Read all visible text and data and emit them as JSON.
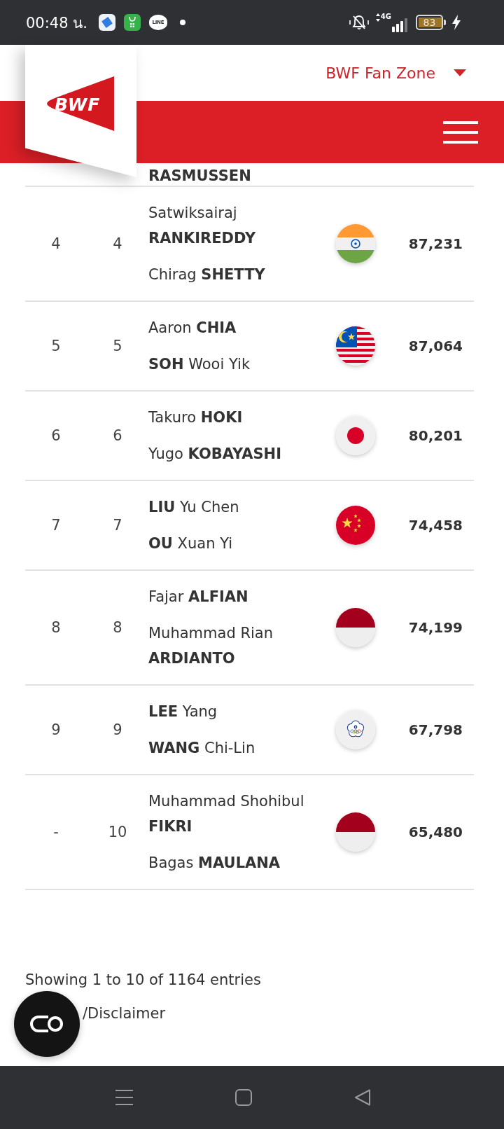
{
  "status_bar": {
    "time": "00:48 น.",
    "chat_app_label": "LINE",
    "network": "4G",
    "battery": "83"
  },
  "header": {
    "logo": "BWF",
    "site_menu": "BWF Fan Zone"
  },
  "ranking": {
    "partial_row": {
      "player": "RASMUSSEN"
    },
    "rows": [
      {
        "column_1": "4",
        "column_2": "4",
        "players": [
          "Satwiksairaj **RANKIREDDY**",
          "Chirag **SHETTY**"
        ],
        "kind": "india",
        "points": "87,231"
      },
      {
        "column_1": "5",
        "column_2": "5",
        "players": [
          "Aaron **CHIA**",
          "**SOH** Wooi Yik"
        ],
        "kind": "malaysia",
        "points": "87,064"
      },
      {
        "column_1": "6",
        "column_2": "6",
        "players": [
          "Takuro **HOKI**",
          "Yugo **KOBAYASHI**"
        ],
        "kind": "japan",
        "points": "80,201"
      },
      {
        "column_1": "7",
        "column_2": "7",
        "players": [
          "**LIU** Yu Chen",
          "**OU** Xuan Yi"
        ],
        "kind": "china",
        "points": "74,458"
      },
      {
        "column_1": "8",
        "column_2": "8",
        "players": [
          "Fajar **ALFIAN**",
          "Muhammad Rian **ARDIANTO**"
        ],
        "kind": "indonesia",
        "points": "74,199"
      },
      {
        "column_1": "9",
        "column_2": "9",
        "players": [
          "**LEE** Yang",
          "**WANG** Chi-Lin"
        ],
        "kind": "taipei",
        "points": "67,798"
      },
      {
        "column_1": "-",
        "column_2": "10",
        "players": [
          "Muhammad Shohibul **FIKRI**",
          "Bagas **MAULANA**"
        ],
        "kind": "indonesia",
        "points": "65,480"
      }
    ]
  },
  "footer": {
    "summary": "Showing 1 to 10 of 1164 entries",
    "link": "/Disclaimer"
  }
}
